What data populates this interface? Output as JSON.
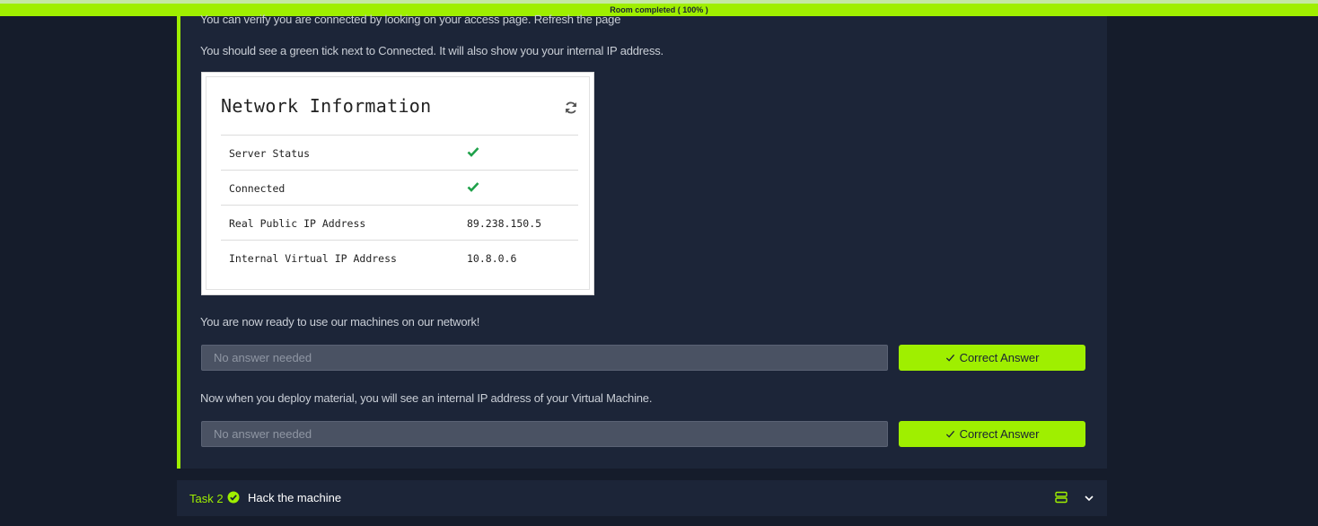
{
  "progress": {
    "text": "Room completed ( 100% )",
    "percent": 100
  },
  "task": {
    "para_verify": "You can verify you are connected by looking on your access page. Refresh the page",
    "para_tick": "You should see a green tick next to Connected. It will also show you your internal IP address.",
    "network_card": {
      "title": "Network Information",
      "rows": [
        {
          "label": "Server Status",
          "value": "",
          "icon": "check-icon"
        },
        {
          "label": "Connected",
          "value": "",
          "icon": "check-icon"
        },
        {
          "label": "Real Public IP Address",
          "value": "89.238.150.5"
        },
        {
          "label": "Internal Virtual IP Address",
          "value": "10.8.0.6"
        }
      ]
    },
    "para_ready": "You are now ready to use our machines on our network!",
    "q1": {
      "placeholder": "No answer needed",
      "button_label": "Correct Answer"
    },
    "para_deploy": "Now when you deploy material, you will see an internal IP address of your Virtual Machine.",
    "q2": {
      "placeholder": "No answer needed",
      "button_label": "Correct Answer"
    }
  },
  "task2": {
    "number": "Task 2",
    "title": "Hack the machine"
  },
  "colors": {
    "accent": "#9fef00",
    "background": "#151c2b",
    "panel": "#1c2538",
    "check_green": "#1fa14a"
  }
}
